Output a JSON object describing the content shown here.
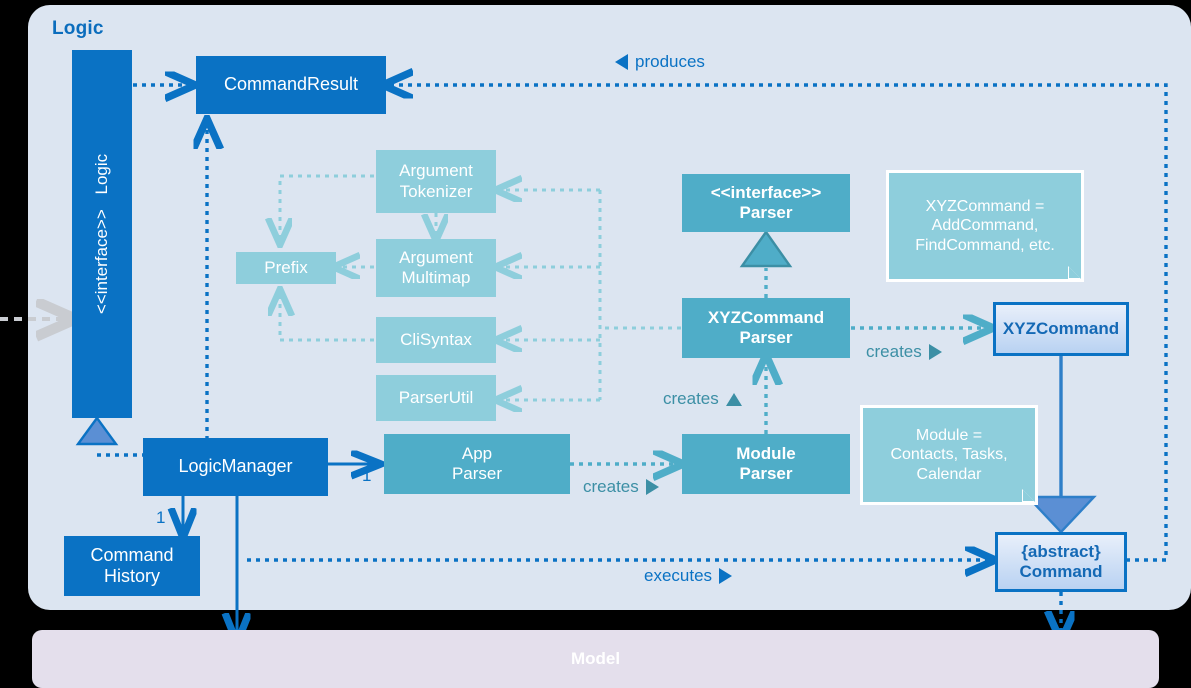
{
  "diagram": {
    "title": "Logic",
    "model_bar_label": "Model"
  },
  "nodes": {
    "logic_interface": {
      "stereotype": "<<interface>>",
      "name": "Logic"
    },
    "command_result": {
      "label": "CommandResult"
    },
    "logic_manager": {
      "label": "LogicManager"
    },
    "command_history": {
      "line1": "Command",
      "line2": "History"
    },
    "app_parser": {
      "line1": "App",
      "line2": "Parser"
    },
    "module_parser": {
      "line1": "Module",
      "line2": "Parser"
    },
    "parser_interface": {
      "stereotype": "<<interface>>",
      "name": "Parser"
    },
    "xyz_command_parser": {
      "line1": "XYZCommand",
      "line2": "Parser"
    },
    "xyz_command": {
      "label": "XYZCommand"
    },
    "abstract_command": {
      "line1": "{abstract}",
      "line2": "Command"
    },
    "argument_tokenizer": {
      "line1": "Argument",
      "line2": "Tokenizer"
    },
    "argument_multimap": {
      "line1": "Argument",
      "line2": "Multimap"
    },
    "prefix": {
      "label": "Prefix"
    },
    "cli_syntax": {
      "label": "CliSyntax"
    },
    "parser_util": {
      "label": "ParserUtil"
    }
  },
  "notes": {
    "xyz_note": {
      "line1": "XYZCommand =",
      "line2": "AddCommand,",
      "line3": "FindCommand, etc."
    },
    "module_note": {
      "line1": "Module =",
      "line2": "Contacts, Tasks,",
      "line3": "Calendar"
    }
  },
  "edge_labels": {
    "produces": "produces",
    "creates_app_to_module": "creates",
    "creates_parser_up": "creates",
    "creates_xyz": "creates",
    "executes": "executes"
  },
  "multiplicities": {
    "logic_manager_to_app_parser": "1",
    "logic_manager_to_command_history": "1"
  },
  "colors": {
    "panel_background": "#DCE5F1",
    "blue": "#0A72C4",
    "teal": "#4FADC8",
    "teal_light": "#8ECEDC",
    "teal_text": "#3C8FA5",
    "model_bar": "#E4DFEC",
    "canvas": "#000000"
  }
}
